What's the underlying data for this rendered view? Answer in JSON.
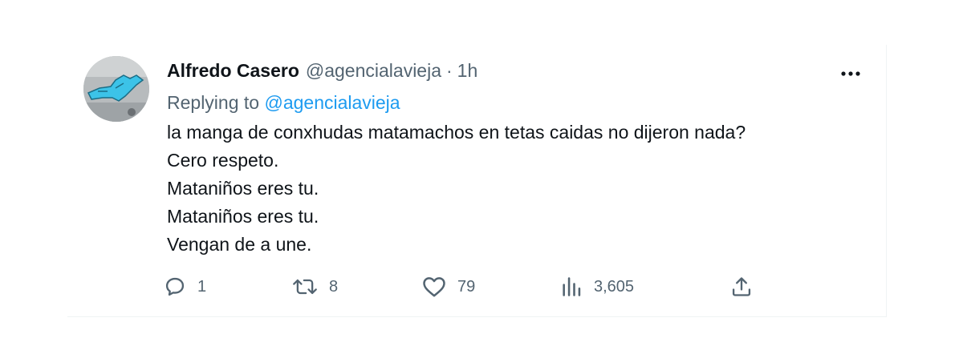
{
  "tweet": {
    "author_name": "Alfredo Casero",
    "author_handle": "@agencialavieja",
    "separator": "·",
    "timestamp": "1h",
    "replying_prefix": "Replying to",
    "replying_handle": "@agencialavieja",
    "body_lines": [
      "la manga de conxhudas matamachos en tetas caidas no dijeron nada?",
      "Cero respeto.",
      "Mataniños eres tu.",
      "Mataniños eres tu.",
      "Vengan de a une."
    ],
    "actions": {
      "reply_count": "1",
      "retweet_count": "8",
      "like_count": "79",
      "views_count": "3,605"
    }
  },
  "icons": {
    "more": "more-horizontal-icon",
    "reply": "reply-bubble-icon",
    "retweet": "retweet-icon",
    "like": "heart-icon",
    "views": "bar-chart-icon",
    "share": "share-upload-icon"
  },
  "colors": {
    "text": "#0f1419",
    "secondary": "#536471",
    "accent": "#1d9bf0"
  }
}
